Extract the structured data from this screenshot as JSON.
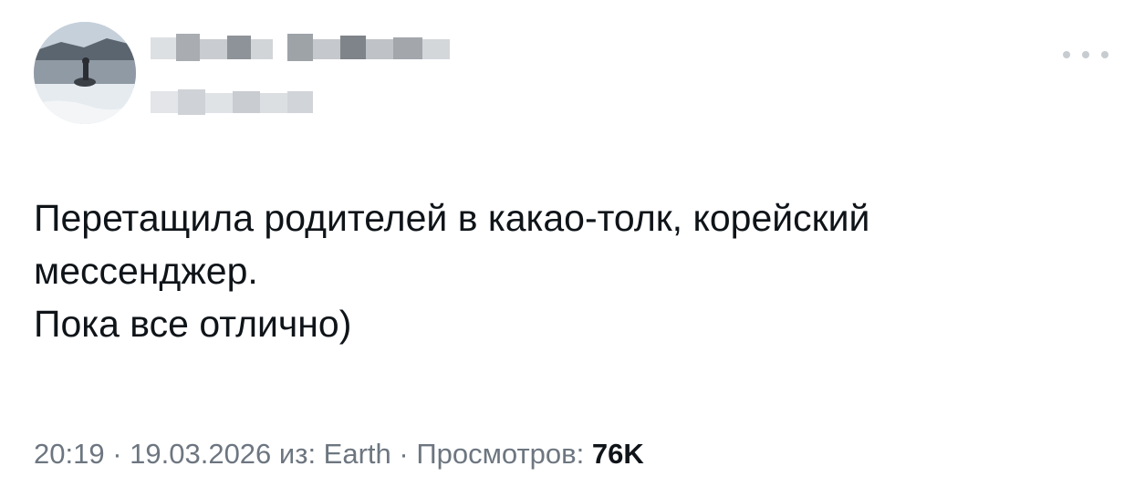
{
  "tweet": {
    "text_lines": [
      "Перетащила родителей в какао-толк, корейский",
      "мессенджер.",
      "Пока все отлично)"
    ],
    "time": "20:19",
    "separator": " · ",
    "date": "19.03.2026",
    "source_prefix": " из: ",
    "source": "Earth",
    "views_label": "Просмотров: ",
    "views_count": "76K"
  },
  "icons": {
    "more": "more-options-icon"
  },
  "colors": {
    "text": "#0f1419",
    "meta": "#6d7680",
    "more_dots": "#c7ccd1"
  }
}
